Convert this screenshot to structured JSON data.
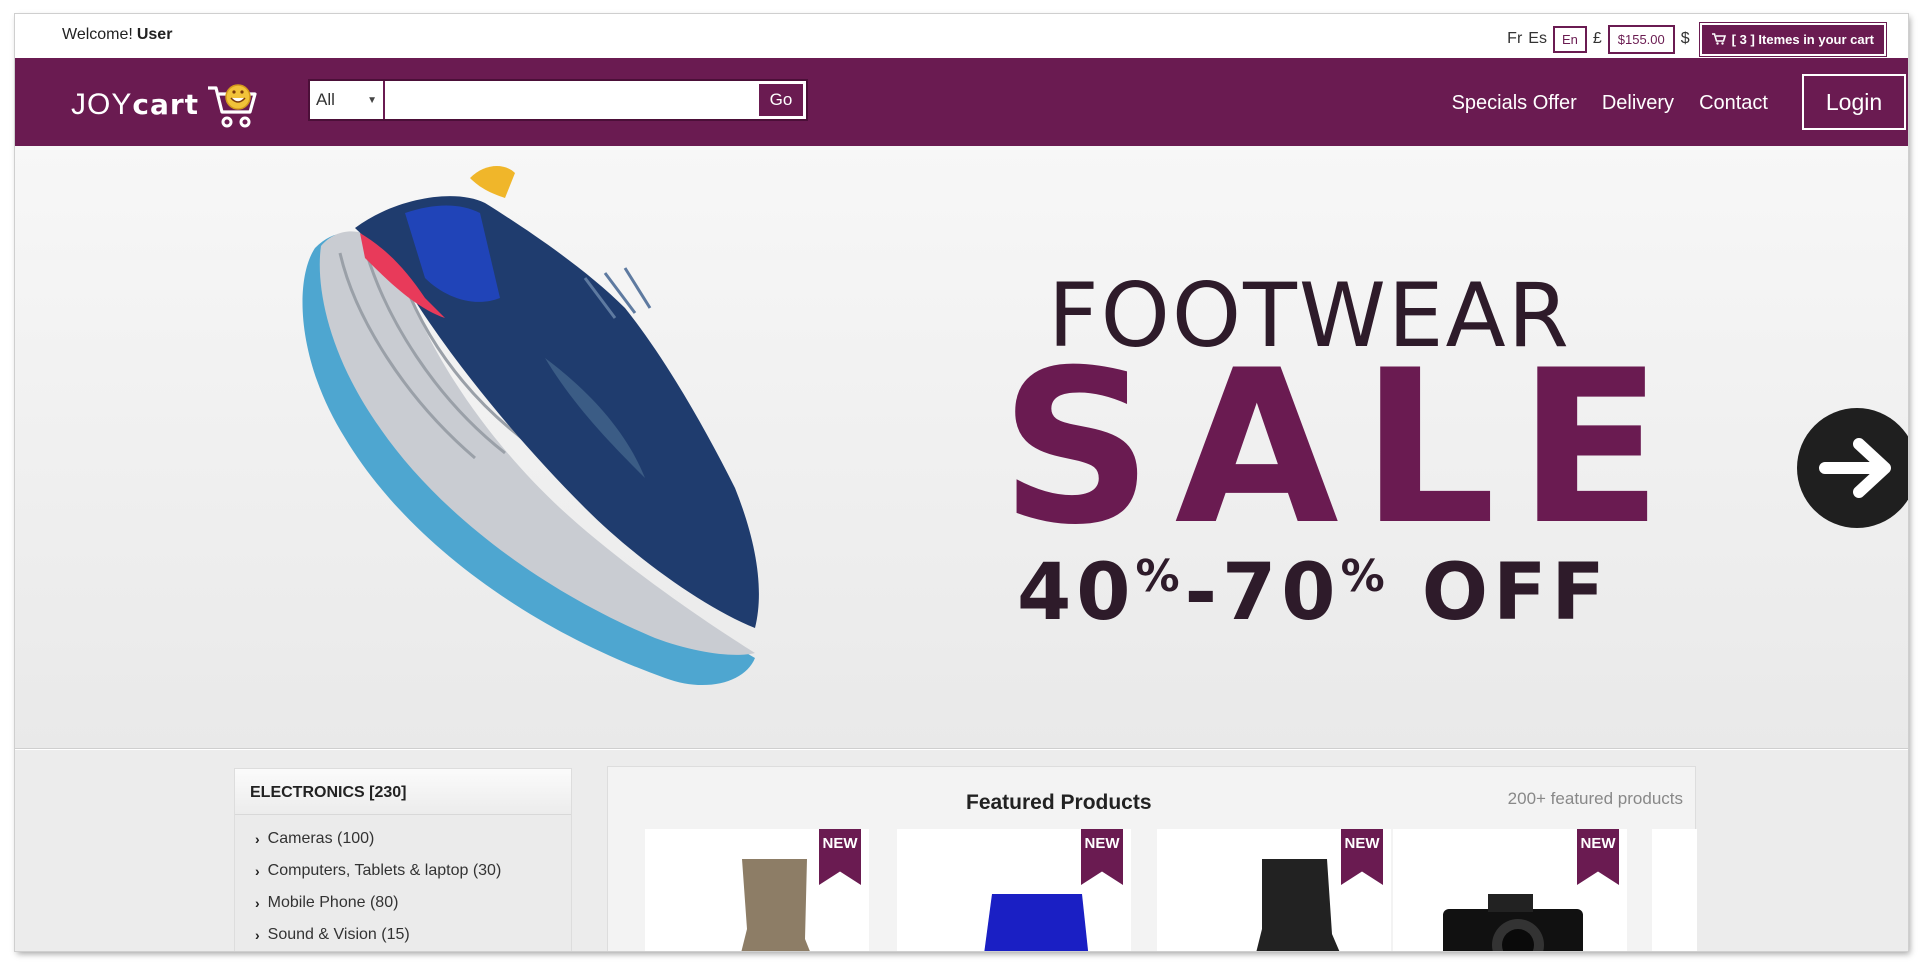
{
  "topbar": {
    "welcome_text": "Welcome!",
    "user_name": "User",
    "languages": [
      "Fr",
      "Es",
      "En"
    ],
    "selected_language": "En",
    "currency_left": "£",
    "price": "$155.00",
    "currency_right": "$",
    "cart_label": "[ 3 ] Itemes in your cart"
  },
  "navbar": {
    "logo_text_light": "JOY",
    "logo_text_bold": "cart",
    "search": {
      "category_selected": "All",
      "placeholder": "",
      "go_label": "Go"
    },
    "links": [
      "Specials Offer",
      "Delivery",
      "Contact"
    ],
    "login_label": "Login"
  },
  "hero": {
    "line1": "FOOTWEAR",
    "line2": "SALE",
    "line3_a": "40",
    "line3_pct1": "%",
    "line3_b": "-70",
    "line3_pct2": "%",
    "line3_c": " OFF"
  },
  "categories": {
    "title": "ELECTRONICS [230]",
    "items": [
      {
        "label": "Cameras (100)"
      },
      {
        "label": "Computers, Tablets & laptop (30)"
      },
      {
        "label": "Mobile Phone (80)"
      },
      {
        "label": "Sound & Vision (15)"
      }
    ]
  },
  "featured": {
    "title": "Featured Products",
    "count_label": "200+ featured products",
    "badge": "NEW",
    "products": [
      {
        "badge": "NEW"
      },
      {
        "badge": "NEW"
      },
      {
        "badge": "NEW"
      },
      {
        "badge": "NEW"
      }
    ]
  },
  "colors": {
    "brand": "#6a1b51",
    "hero_dark_text": "#2e1b2a",
    "shoe_blue": "#1f3c6e",
    "sole_blue": "#4ea6d0"
  }
}
